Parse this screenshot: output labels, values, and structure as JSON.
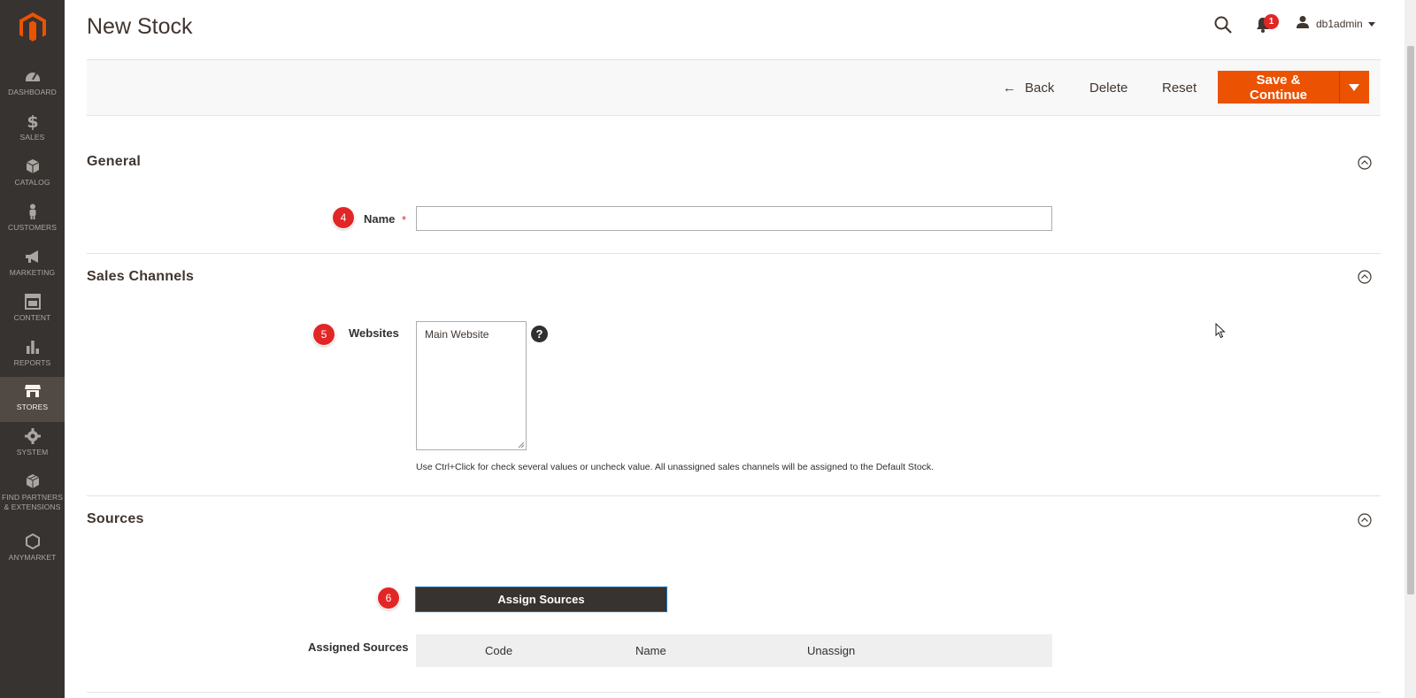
{
  "sidebar": {
    "items": [
      {
        "label": "DASHBOARD",
        "icon": "dashboard-icon"
      },
      {
        "label": "SALES",
        "icon": "dollar-icon"
      },
      {
        "label": "CATALOG",
        "icon": "box-icon"
      },
      {
        "label": "CUSTOMERS",
        "icon": "person-icon"
      },
      {
        "label": "MARKETING",
        "icon": "megaphone-icon"
      },
      {
        "label": "CONTENT",
        "icon": "layout-icon"
      },
      {
        "label": "REPORTS",
        "icon": "bar-chart-icon"
      },
      {
        "label": "STORES",
        "icon": "store-icon"
      },
      {
        "label": "SYSTEM",
        "icon": "gear-icon"
      },
      {
        "label": "FIND PARTNERS & EXTENSIONS",
        "icon": "blocks-icon"
      },
      {
        "label": "ANYMARKET",
        "icon": "hexagon-icon"
      }
    ],
    "active": "STORES"
  },
  "header": {
    "title": "New Stock",
    "notification_count": "1",
    "username": "db1admin"
  },
  "actions": {
    "back": "Back",
    "delete": "Delete",
    "reset": "Reset",
    "save": "Save & Continue"
  },
  "general": {
    "title": "General",
    "name_label": "Name",
    "name_value": "",
    "step": "4"
  },
  "sales_channels": {
    "title": "Sales Channels",
    "websites_label": "Websites",
    "websites_options": [
      "Main Website"
    ],
    "note": "Use Ctrl+Click for check several values or uncheck value. All unassigned sales channels will be assigned to the Default Stock.",
    "help": "?",
    "step": "5"
  },
  "sources": {
    "title": "Sources",
    "assign_button": "Assign Sources",
    "assigned_label": "Assigned Sources",
    "columns": [
      "Code",
      "Name",
      "Unassign"
    ],
    "step": "6"
  },
  "colors": {
    "accent": "#eb5202",
    "sidebar_bg": "#373330",
    "badge": "#e22626"
  }
}
